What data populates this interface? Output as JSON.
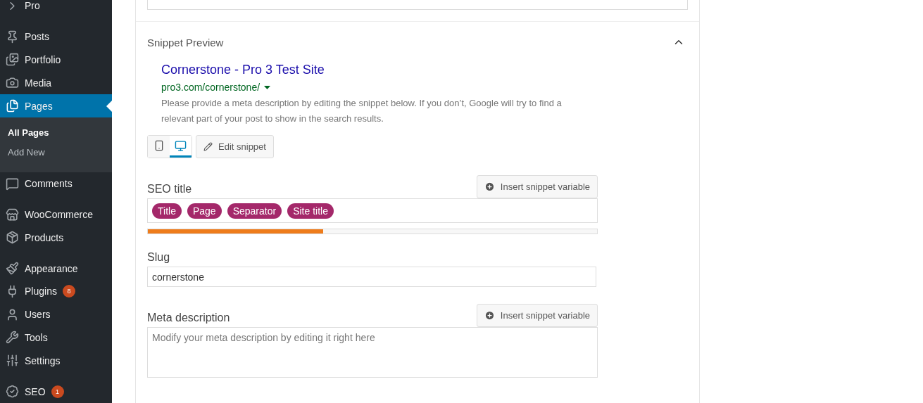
{
  "sidebar": {
    "items": [
      {
        "label": "Pro",
        "selected": false,
        "group_start": false
      },
      {
        "label": "Posts",
        "selected": false,
        "group_start": true
      },
      {
        "label": "Portfolio",
        "selected": false,
        "group_start": false
      },
      {
        "label": "Media",
        "selected": false,
        "group_start": false
      },
      {
        "label": "Pages",
        "selected": true,
        "group_start": false,
        "children": [
          {
            "label": "All Pages",
            "selected": true
          },
          {
            "label": "Add New",
            "selected": false
          }
        ]
      },
      {
        "label": "Comments",
        "selected": false,
        "group_start": false
      },
      {
        "label": "WooCommerce",
        "selected": false,
        "group_start": true
      },
      {
        "label": "Products",
        "selected": false,
        "group_start": false
      },
      {
        "label": "Appearance",
        "selected": false,
        "group_start": true
      },
      {
        "label": "Plugins",
        "selected": false,
        "group_start": false,
        "badge": "8"
      },
      {
        "label": "Users",
        "selected": false,
        "group_start": false
      },
      {
        "label": "Tools",
        "selected": false,
        "group_start": false
      },
      {
        "label": "Settings",
        "selected": false,
        "group_start": false
      },
      {
        "label": "SEO",
        "selected": false,
        "group_start": true,
        "badge": "1"
      }
    ]
  },
  "snippet_preview": {
    "title": "Snippet Preview",
    "expanded": true,
    "preview": {
      "page_title": "Cornerstone - Pro 3 Test Site",
      "url": "pro3.com/cornerstone/",
      "description": "Please provide a meta description by editing the snippet below. If you don’t, Google will try to find a relevant part of your post to show in the search results."
    },
    "devices": [
      {
        "kind": "mobile",
        "selected": false
      },
      {
        "kind": "desktop",
        "selected": true
      }
    ],
    "edit_button": "Edit snippet",
    "seo_title": {
      "label": "SEO title",
      "insert_button": "Insert snippet variable",
      "tags": [
        "Title",
        "Page",
        "Separator",
        "Site title"
      ],
      "level": 0.39
    },
    "slug": {
      "label": "Slug",
      "value": "cornerstone"
    },
    "meta_description": {
      "label": "Meta description",
      "insert_button": "Insert snippet variable",
      "placeholder": "Modify your meta description by editing it right here"
    }
  }
}
